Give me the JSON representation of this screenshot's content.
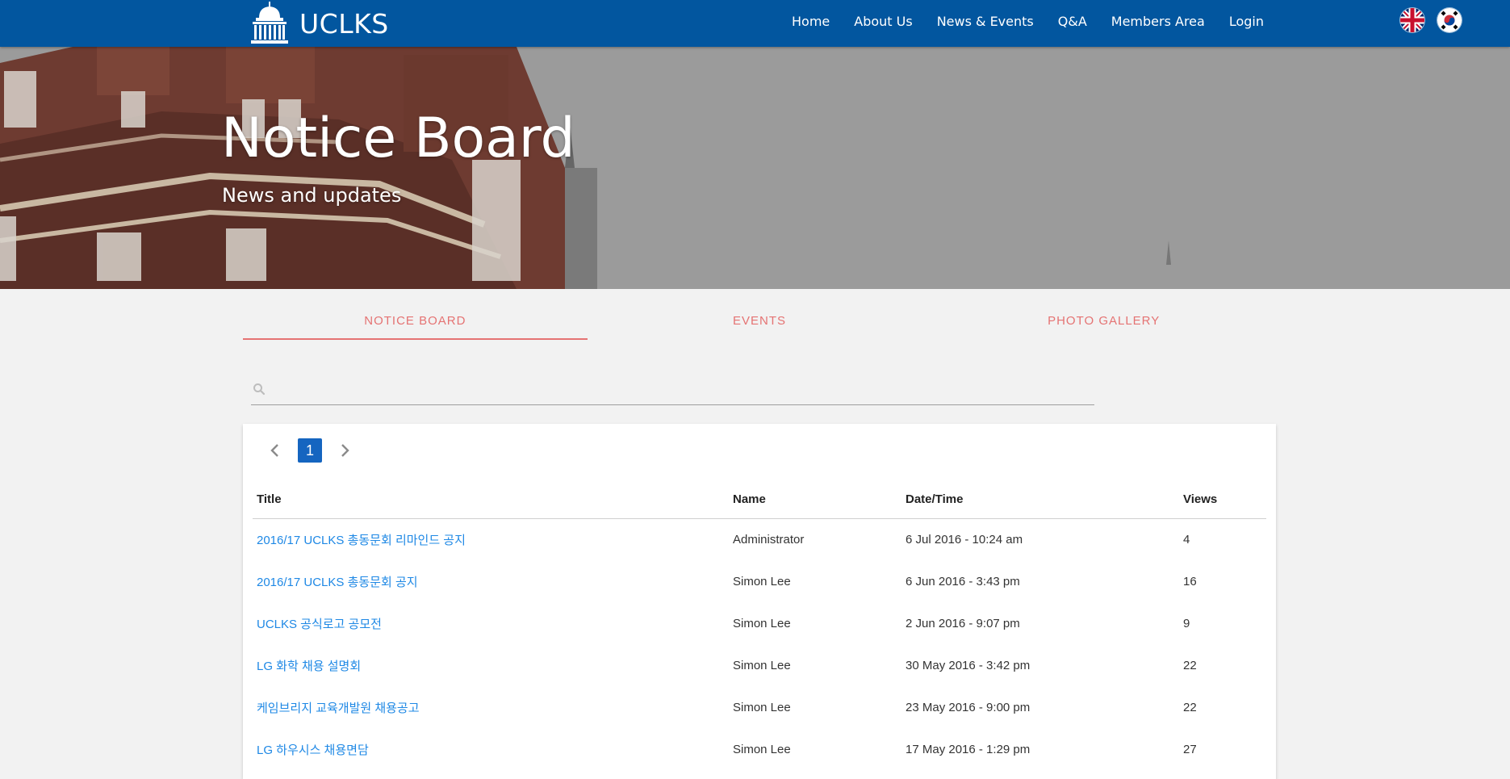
{
  "brand": {
    "name": "UCLKS"
  },
  "nav": {
    "items": [
      {
        "label": "Home"
      },
      {
        "label": "About Us"
      },
      {
        "label": "News & Events"
      },
      {
        "label": "Q&A"
      },
      {
        "label": "Members Area"
      },
      {
        "label": "Login"
      }
    ]
  },
  "languages": [
    "english-flag-icon",
    "korean-flag-icon"
  ],
  "hero": {
    "title": "Notice Board",
    "subtitle": "News and updates"
  },
  "tabs": [
    {
      "label": "NOTICE BOARD",
      "active": true
    },
    {
      "label": "EVENTS",
      "active": false
    },
    {
      "label": "PHOTO GALLERY",
      "active": false
    }
  ],
  "search": {
    "placeholder": "",
    "value": ""
  },
  "pagination": {
    "current_page": "1"
  },
  "table": {
    "headers": {
      "title": "Title",
      "name": "Name",
      "datetime": "Date/Time",
      "views": "Views"
    },
    "rows": [
      {
        "title": "2016/17 UCLKS 총동문회 리마인드 공지",
        "name": "Administrator",
        "datetime": "6 Jul 2016 - 10:24 am",
        "views": "4"
      },
      {
        "title": "2016/17 UCLKS 총동문회 공지",
        "name": "Simon Lee",
        "datetime": "6 Jun 2016 - 3:43 pm",
        "views": "16"
      },
      {
        "title": "UCLKS 공식로고 공모전",
        "name": "Simon Lee",
        "datetime": "2 Jun 2016 - 9:07 pm",
        "views": "9"
      },
      {
        "title": "LG 화학 채용 설명회",
        "name": "Simon Lee",
        "datetime": "30 May 2016 - 3:42 pm",
        "views": "22"
      },
      {
        "title": "케임브리지 교육개발원 채용공고",
        "name": "Simon Lee",
        "datetime": "23 May 2016 - 9:00 pm",
        "views": "22"
      },
      {
        "title": "LG 하우시스 채용면담",
        "name": "Simon Lee",
        "datetime": "17 May 2016 - 1:29 pm",
        "views": "27"
      }
    ]
  },
  "colors": {
    "navbar": "#02569f",
    "accent": "#e57373",
    "link": "#1e88e5",
    "page_active": "#1565c0"
  }
}
